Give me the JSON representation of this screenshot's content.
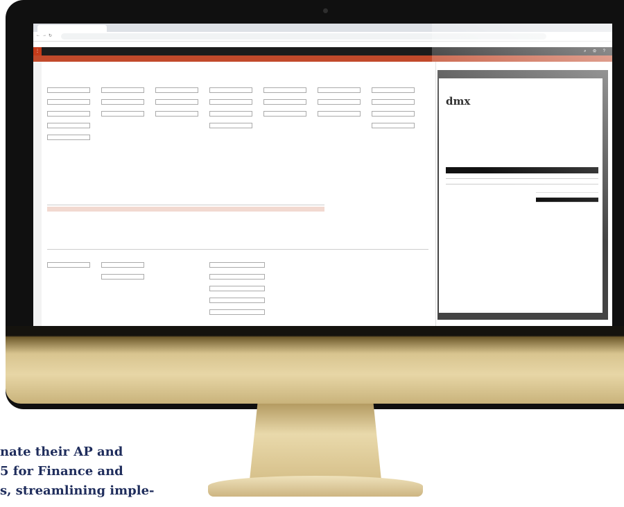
{
  "tagline": {
    "line1": "nate their AP and",
    "line2": "5 for Finance and",
    "line3": "s, streamlining imple-"
  },
  "browser": {
    "tab_title": "",
    "url": ""
  },
  "app": {
    "title": "",
    "accent": "#c24a2b"
  },
  "document": {
    "logo_text": "dmx",
    "invoice_title": "",
    "total_label": ""
  },
  "colors": {
    "frame": "#101010",
    "stand": "#d8c48f",
    "tagline": "#1f2d5c"
  }
}
